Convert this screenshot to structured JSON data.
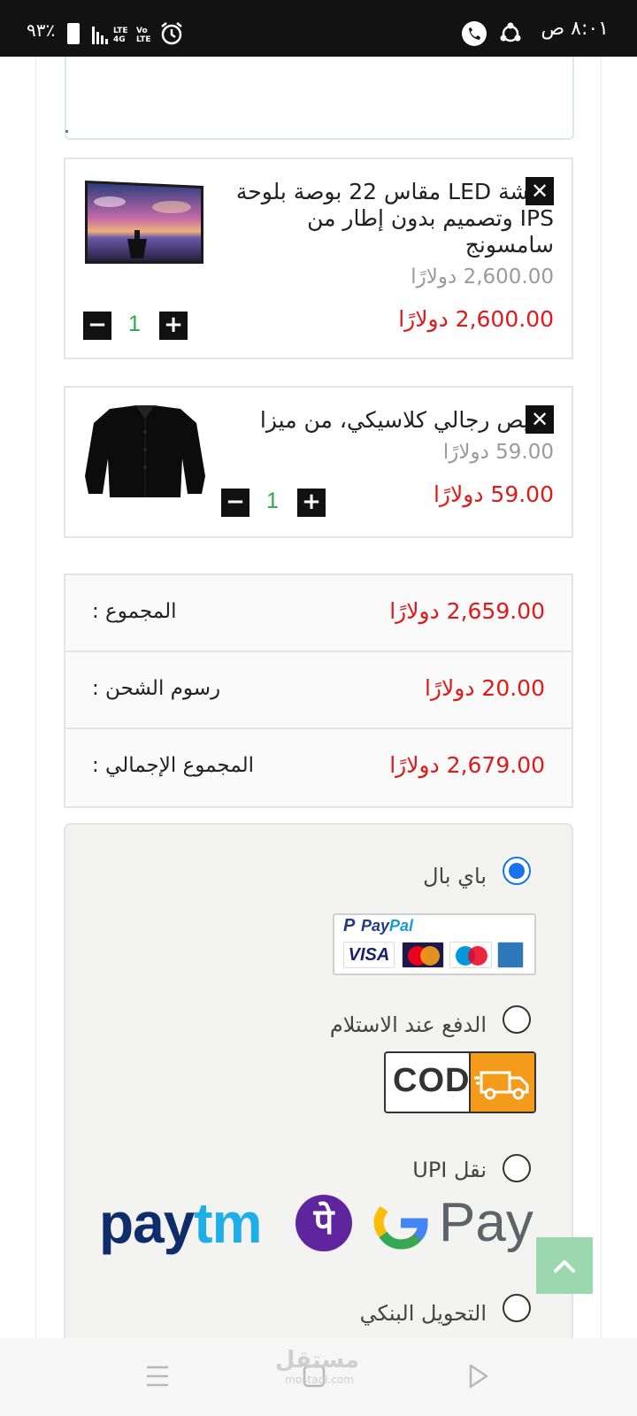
{
  "status_bar": {
    "time": "٨:٠١ ص",
    "battery": "٪٩٣",
    "lte_top": "LTE",
    "lte_bottom": "4G",
    "volte_top": "Vo",
    "volte_bottom": "LTE"
  },
  "cart": {
    "items": [
      {
        "title": "شاشة LED مقاس 22 بوصة بلوحة IPS وتصميم بدون إطار من سامسونج",
        "old_price": "2,600.00 دولارًا",
        "price": "2,600.00 دولارًا",
        "quantity": "1",
        "remove_icon": "close-icon",
        "image": "tv-monitor"
      },
      {
        "title": "قميص رجالي كلاسيكي، من ميزا",
        "old_price": "59.00 دولارًا",
        "price": "59.00 دولارًا",
        "quantity": "1",
        "remove_icon": "close-icon",
        "image": "black-shirt"
      }
    ]
  },
  "totals": {
    "subtotal_label": "المجموع :",
    "subtotal_value": "2,659.00 دولارًا",
    "shipping_label": "رسوم الشحن :",
    "shipping_value": "20.00 دولارًا",
    "grand_label": "المجموع الإجمالي :",
    "grand_value": "2,679.00 دولارًا"
  },
  "payment": {
    "options": [
      {
        "label": "باي بال",
        "selected": true
      },
      {
        "label": "الدفع عند الاستلام",
        "selected": false
      },
      {
        "label": "نقل UPI",
        "selected": false
      },
      {
        "label": "التحويل البنكي",
        "selected": false
      }
    ],
    "paypal_logo": {
      "pay": "Pay",
      "pal": "Pal",
      "p": "P",
      "visa": "VISA"
    },
    "cod_logo": "COD",
    "upi_logos": {
      "paytm_pay": "pay",
      "paytm_tm": "tm",
      "phonepe": "पे",
      "gpay_pay": "Pay"
    }
  },
  "watermark": {
    "main": "مستقل",
    "sub": "mostaql.com"
  },
  "colors": {
    "accent_red": "#e01a1a",
    "quantity_green": "#2ea84a",
    "radio_blue": "#1a73e8",
    "scroll_top_bg": "#9bd8ad",
    "cod_orange": "#f59b1b"
  }
}
